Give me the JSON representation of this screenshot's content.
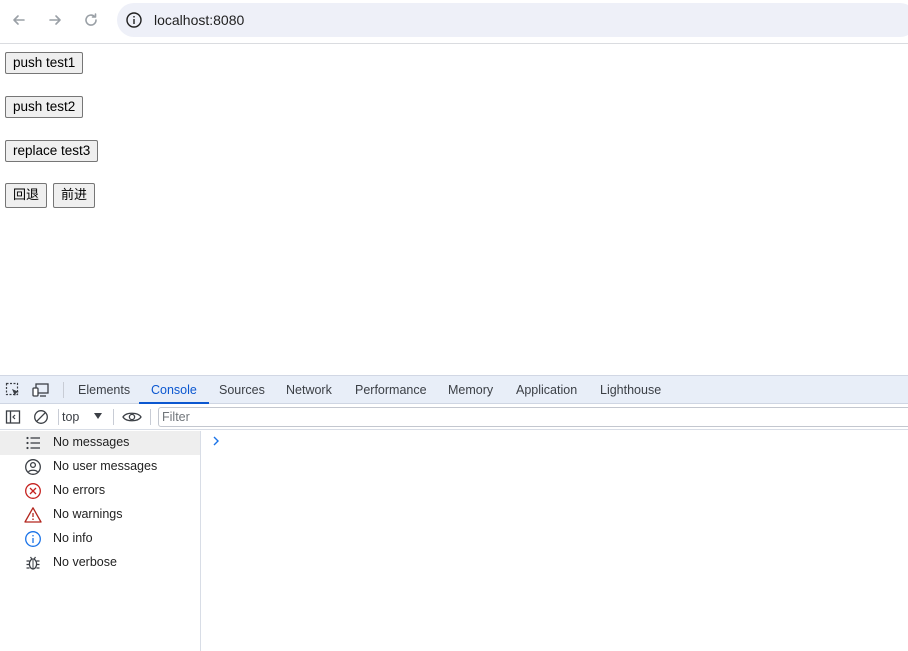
{
  "browser": {
    "url": "localhost:8080"
  },
  "page": {
    "buttons": {
      "push_test1": "push test1",
      "push_test2": "push test2",
      "replace_test3": "replace test3",
      "back": "回退",
      "forward": "前进"
    }
  },
  "devtools": {
    "tabs": [
      "Elements",
      "Console",
      "Sources",
      "Network",
      "Performance",
      "Memory",
      "Application",
      "Lighthouse"
    ],
    "active_tab": "Console",
    "context": "top",
    "filter_placeholder": "Filter",
    "sidebar": [
      {
        "label": "No messages",
        "icon": "list-icon"
      },
      {
        "label": "No user messages",
        "icon": "user-icon"
      },
      {
        "label": "No errors",
        "icon": "error-icon"
      },
      {
        "label": "No warnings",
        "icon": "warning-icon"
      },
      {
        "label": "No info",
        "icon": "info-icon"
      },
      {
        "label": "No verbose",
        "icon": "bug-icon"
      }
    ],
    "colors": {
      "accent": "#0b57d0",
      "error": "#c5221f",
      "warning": "#b3261e",
      "info": "#1a73e8"
    }
  }
}
